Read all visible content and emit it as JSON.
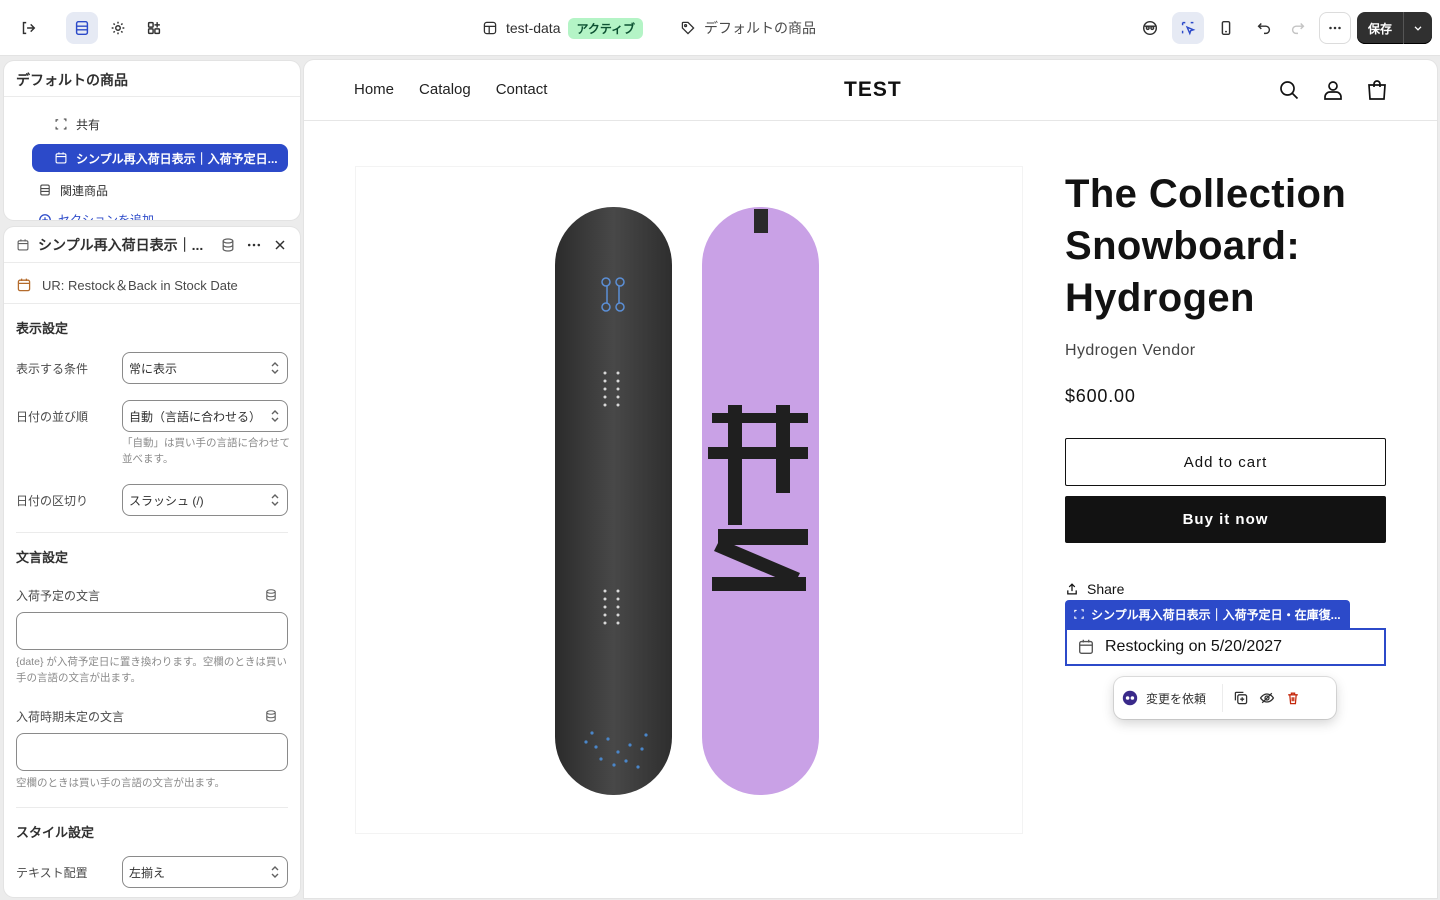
{
  "topbar": {
    "store_name": "test-data",
    "status_badge": "アクティブ",
    "template_name": "デフォルトの商品",
    "save_label": "保存"
  },
  "outline": {
    "title": "デフォルトの商品",
    "items": [
      {
        "label": "共有",
        "icon": "block-icon"
      },
      {
        "label": "シンプル再入荷日表示｜入荷予定日...",
        "icon": "app-block-icon",
        "selected": true
      },
      {
        "label": "関連商品",
        "icon": "section-icon"
      }
    ],
    "add_section": "セクションを追加"
  },
  "settings": {
    "title": "シンプル再入荷日表示｜...",
    "app_name": "UR: Restock＆Back in Stock Date",
    "display_section": "表示設定",
    "condition_label": "表示する条件",
    "condition_value": "常に表示",
    "order_label": "日付の並び順",
    "order_value": "自動（言語に合わせる）",
    "order_help": "「自動」は買い手の言語に合わせて並べます。",
    "separator_label": "日付の区切り",
    "separator_value": "スラッシュ (/)",
    "text_section": "文言設定",
    "incoming_label": "入荷予定の文言",
    "incoming_value": "",
    "incoming_help": "{date} が入荷予定日に置き換わります。空欄のときは買い手の言語の文言が出ます。",
    "undecided_label": "入荷時期未定の文言",
    "undecided_value": "",
    "undecided_help": "空欄のときは買い手の言語の文言が出ます。",
    "style_section": "スタイル設定",
    "align_label": "テキスト配置",
    "align_value": "左揃え"
  },
  "preview": {
    "nav": [
      "Home",
      "Catalog",
      "Contact"
    ],
    "logo": "TEST",
    "product_title": "The Collection Snowboard: Hydrogen",
    "vendor": "Hydrogen Vendor",
    "price": "$600.00",
    "add_to_cart": "Add to cart",
    "buy_now": "Buy it now",
    "share": "Share",
    "block_tag": "シンプル再入荷日表示｜入荷予定日・在庫復...",
    "restock_text": "Restocking on 5/20/2027",
    "toolbar_request": "変更を依頼"
  },
  "colors": {
    "accent": "#2c4ac9",
    "badge_bg": "#b4f4c6",
    "board_dark": "#3a3a3a",
    "board_purple": "#c9a1e6"
  }
}
